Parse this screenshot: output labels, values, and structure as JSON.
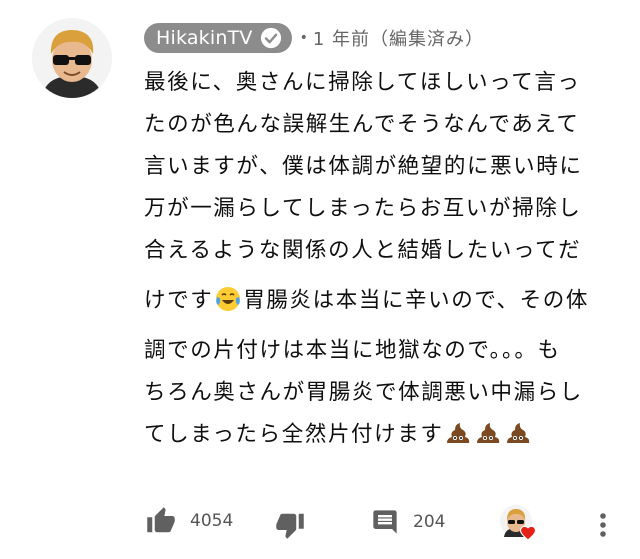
{
  "comment": {
    "channel_name": "HikakinTV",
    "verified_icon": "check-circle-icon",
    "separator": "•",
    "timestamp": "1 年前（編集済み）",
    "lines": [
      "最後に、奥さんに掃除してほしいって言っ",
      "たのが色んな誤解生んでそうなんであえて",
      "言いますが、僕は体調が絶望的に悪い時に",
      "万が一漏らしてしまったらお互いが掃除し",
      "合えるような関係の人と結婚したいってだ",
      {
        "before": "けです",
        "emoji": "joy-tears-emoji",
        "after": "胃腸炎は本当に辛いので、その体"
      },
      "調での片付けは本当に地獄なので。。。も",
      "ちろん奥さんが胃腸炎で体調悪い中漏らし",
      {
        "before": "てしまったら全然片付けます",
        "emoji": "poop-emoji x3"
      }
    ]
  },
  "actions": {
    "like_icon": "thumbs-up-icon",
    "like_count": "4054",
    "dislike_icon": "thumbs-down-icon",
    "reply_icon": "comment-icon",
    "reply_count": "204",
    "creator_heart_icon": "heart-icon",
    "more_icon": "more-vertical-icon"
  },
  "colors": {
    "chip_bg": "#8c8c8c",
    "icon_gray": "#606060",
    "heart_red": "#e62117"
  }
}
